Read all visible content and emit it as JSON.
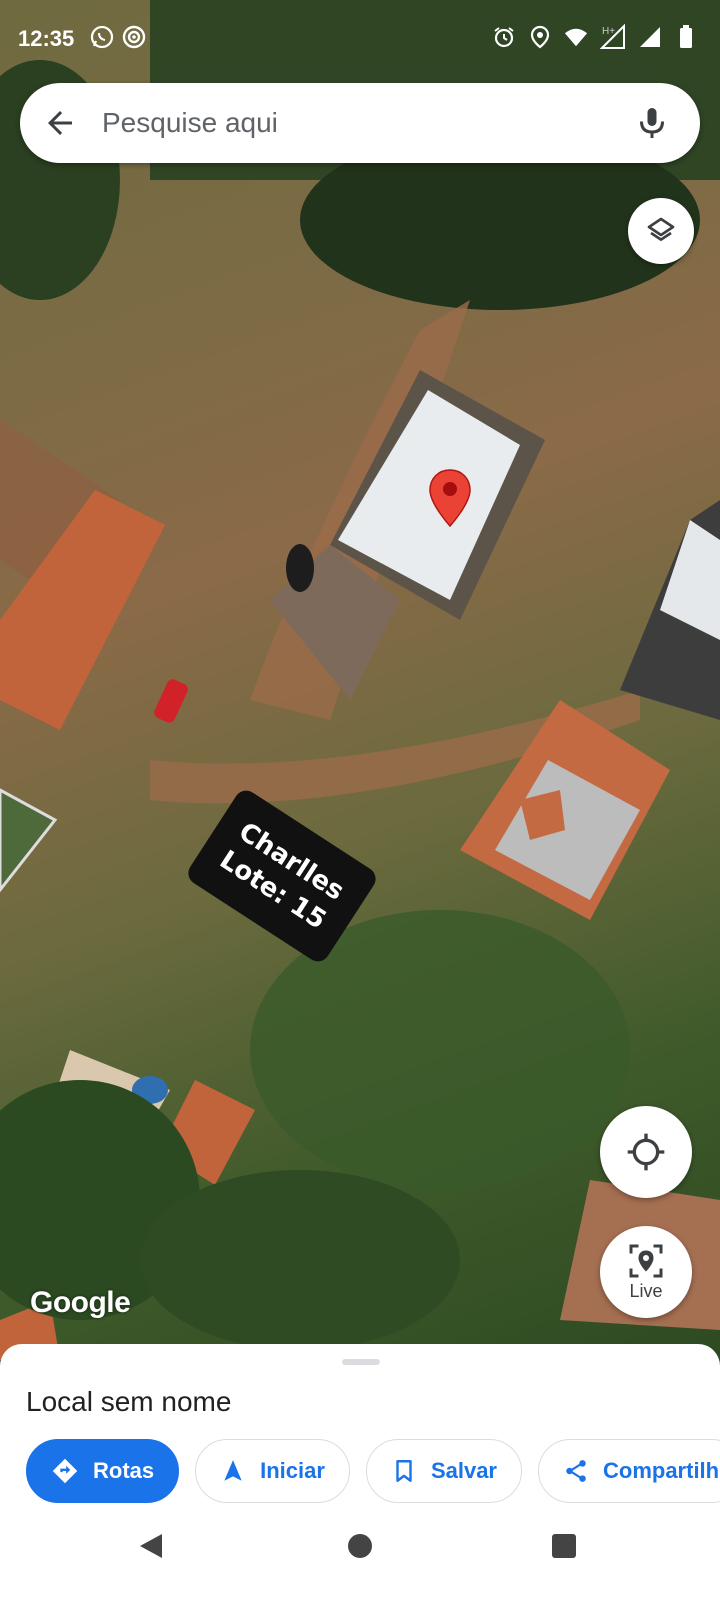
{
  "status_bar": {
    "time": "12:35",
    "left_icons": [
      "whatsapp-icon",
      "signal-app-icon"
    ],
    "right_icons": [
      "alarm-icon",
      "location-icon",
      "wifi-icon",
      "h-plus-icon",
      "signal-icon",
      "signal-icon",
      "battery-icon"
    ],
    "network": "H+"
  },
  "search": {
    "placeholder": "Pesquise aqui"
  },
  "map": {
    "label_line1": "Charlles",
    "label_line2": "Lote: 15",
    "attribution": "Google"
  },
  "map_controls": {
    "live_label": "Live"
  },
  "place_sheet": {
    "title": "Local sem nome",
    "actions": [
      {
        "label": "Rotas",
        "icon": "directions-icon"
      },
      {
        "label": "Iniciar",
        "icon": "navigation-icon"
      },
      {
        "label": "Salvar",
        "icon": "bookmark-icon"
      },
      {
        "label": "Compartilh",
        "icon": "share-icon"
      }
    ]
  },
  "colors": {
    "accent": "#1a73e8",
    "pin": "#ea4335"
  }
}
